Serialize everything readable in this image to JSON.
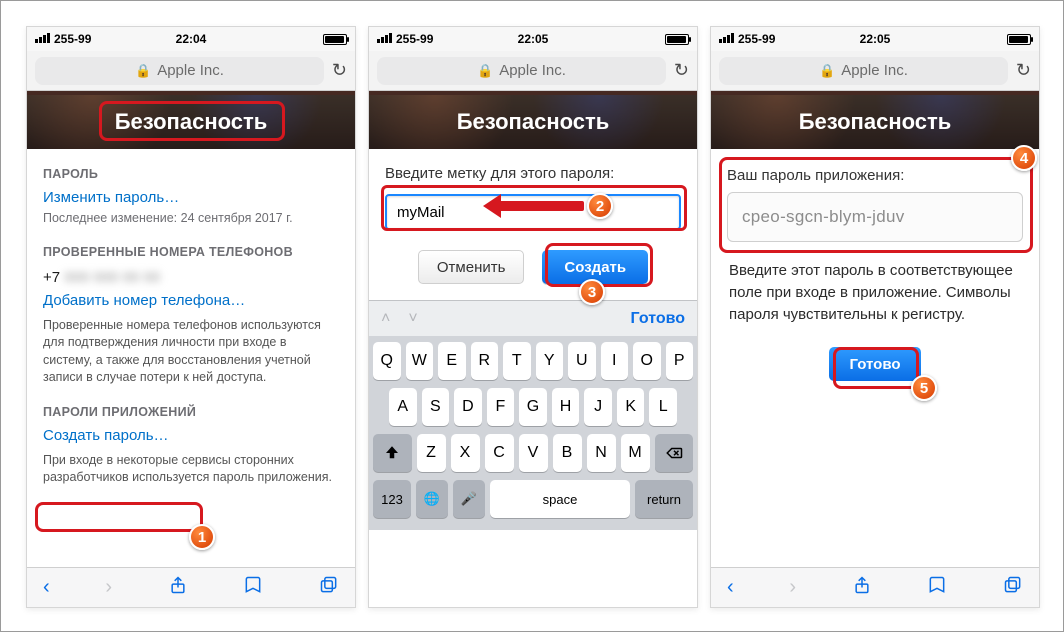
{
  "status": {
    "carrier": "255-99",
    "time1": "22:04",
    "time2": "22:05",
    "time3": "22:05"
  },
  "url": {
    "host": "Apple Inc."
  },
  "banner": {
    "title": "Безопасность"
  },
  "s1": {
    "passwordHeader": "ПАРОЛЬ",
    "changePassword": "Изменить пароль…",
    "lastChange": "Последнее изменение: 24 сентября 2017 г.",
    "phonesHeader": "ПРОВЕРЕННЫЕ НОМЕРА ТЕЛЕФОНОВ",
    "phonePrefix": "+7",
    "phoneBlur": "000 000 00 00",
    "addPhone": "Добавить номер телефона…",
    "phonesDesc": "Проверенные номера телефонов используются для подтверждения личности при входе в систему, а также для восстановления учетной записи в случае потери к ней доступа.",
    "appPwdHeader": "ПАРОЛИ ПРИЛОЖЕНИЙ",
    "createPwd": "Создать пароль…",
    "appPwdDesc1": "При входе в некоторые сервисы сторонних",
    "appPwdDesc2": "разработчиков используется пароль приложения."
  },
  "s2": {
    "prompt": "Введите метку для этого пароля:",
    "inputValue": "myMail",
    "cancel": "Отменить",
    "create": "Создать",
    "kbDone": "Готово",
    "rows": {
      "r1": [
        "Q",
        "W",
        "E",
        "R",
        "T",
        "Y",
        "U",
        "I",
        "O",
        "P"
      ],
      "r2": [
        "A",
        "S",
        "D",
        "F",
        "G",
        "H",
        "J",
        "K",
        "L"
      ],
      "r3": [
        "Z",
        "X",
        "C",
        "V",
        "B",
        "N",
        "M"
      ]
    },
    "k123": "123",
    "space": "space",
    "return": "return"
  },
  "s3": {
    "label": "Ваш пароль приложения:",
    "password": "cpeo-sgcn-blym-jduv",
    "note": "Введите этот пароль в соответствующее поле при входе в приложение. Символы пароля чувствительны к регистру.",
    "done": "Готово"
  },
  "badges": {
    "b1": "1",
    "b2": "2",
    "b3": "3",
    "b4": "4",
    "b5": "5"
  }
}
